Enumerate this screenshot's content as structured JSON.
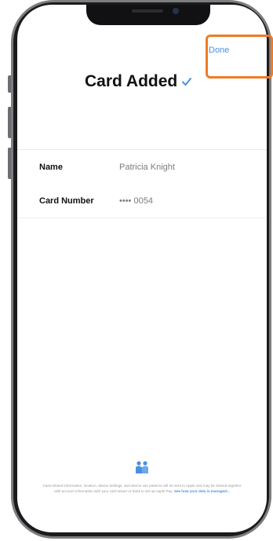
{
  "header": {
    "done_label": "Done"
  },
  "title": "Card Added",
  "details": {
    "name_label": "Name",
    "name_value": "Patricia Knight",
    "card_label": "Card Number",
    "card_value": "•••• 0054"
  },
  "footer": {
    "text": "Card-related information, location, device settings, and device use patterns will be sent to Apple and may be shared together with account information with your card issuer or bank to set up Apple Pay.",
    "link": "See how your data is managed..."
  },
  "colors": {
    "accent": "#4a90e2",
    "highlight": "#f07a24"
  },
  "icons": {
    "title_check": "checkmark-icon",
    "footer": "privacy-handshake-icon"
  }
}
